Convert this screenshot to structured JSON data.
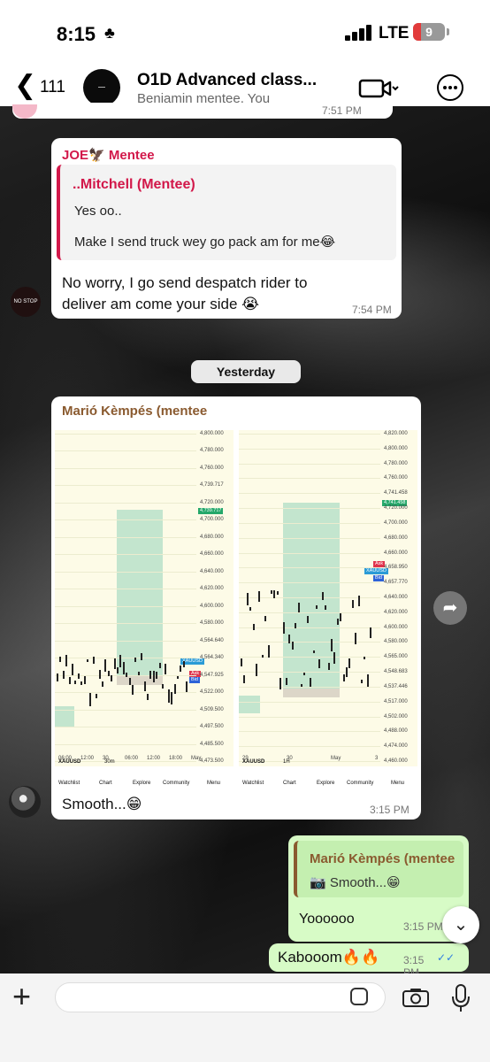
{
  "status": {
    "time": "8:15",
    "network": "LTE",
    "battery": "9"
  },
  "header": {
    "back_count": "111",
    "title": "O1D Advanced class...",
    "subtitle": "Benjamin mentee, You"
  },
  "messages": {
    "partial_time": "7:51 PM",
    "m1": {
      "sender": "JOE🦅 Mentee",
      "quote_name": "..Mitchell (Mentee)",
      "quote_line1": "Yes oo..",
      "quote_line2": "Make I send truck wey go pack am for me😂",
      "text": "No worry, I go send despatch rider to deliver am come your side 😭",
      "time": "7:54 PM",
      "avatar_text": "NO STOP WITHOUT RISK"
    },
    "date_divider": "Yesterday",
    "m2": {
      "sender": "Marió Kèmpés (mentee",
      "text": "Smooth...😁",
      "time": "3:15 PM"
    },
    "m3": {
      "quote_name": "Marió Kèmpés (mentee",
      "quote_text": "📷 Smooth...😁",
      "text": "Yoooooo",
      "time": "3:15 PM"
    },
    "m4": {
      "text": "Kabooom🔥🔥",
      "time": "3:15 PM",
      "ticks": "✓✓"
    }
  },
  "shot1": {
    "ticks": [
      "4,800.000",
      "4,780.000",
      "4,760.000",
      "4,739.717",
      "4,720.000",
      "4,700.000",
      "4,680.000",
      "4,660.000",
      "4,640.000",
      "4,620.000",
      "4,600.000",
      "4,580.000",
      "4,564.640",
      "4,564.340",
      "4,547.925",
      "4,522.000",
      "4,509.500",
      "4,497.500",
      "4,485.500",
      "4,473.500"
    ],
    "xaxis": [
      "06:00",
      "12:00",
      "30",
      "06:00",
      "12:00",
      "18:00",
      "May"
    ],
    "symbol": "XAUUSD",
    "tf": "30m",
    "tags": {
      "top": "4,739.717",
      "mid": "XAUUSD",
      "ask": "Ask",
      "bid": "Bid"
    },
    "toolbar": [
      "Watchlist",
      "Chart",
      "Explore",
      "Community",
      "Menu"
    ]
  },
  "shot2": {
    "ticks": [
      "4,820.000",
      "4,800.000",
      "4,780.000",
      "4,760.000",
      "4,741.458",
      "4,720.000",
      "4,700.000",
      "4,680.000",
      "4,660.000",
      "4,658.950",
      "4,657.770",
      "4,640.000",
      "4,620.000",
      "4,600.000",
      "4,580.000",
      "4,565.000",
      "4,548.683",
      "4,537.446",
      "4,517.000",
      "4,502.000",
      "4,488.000",
      "4,474.000",
      "4,460.000"
    ],
    "xaxis": [
      "29",
      "30",
      "May",
      "3"
    ],
    "symbol": "XAUUSD",
    "tf": "1H",
    "tags": {
      "top": "4,741.458",
      "mid": "XAUUSD",
      "ask": "Ask",
      "bid": "Bid"
    },
    "toolbar": [
      "Watchlist",
      "Chart",
      "Explore",
      "Community",
      "Menu"
    ]
  }
}
